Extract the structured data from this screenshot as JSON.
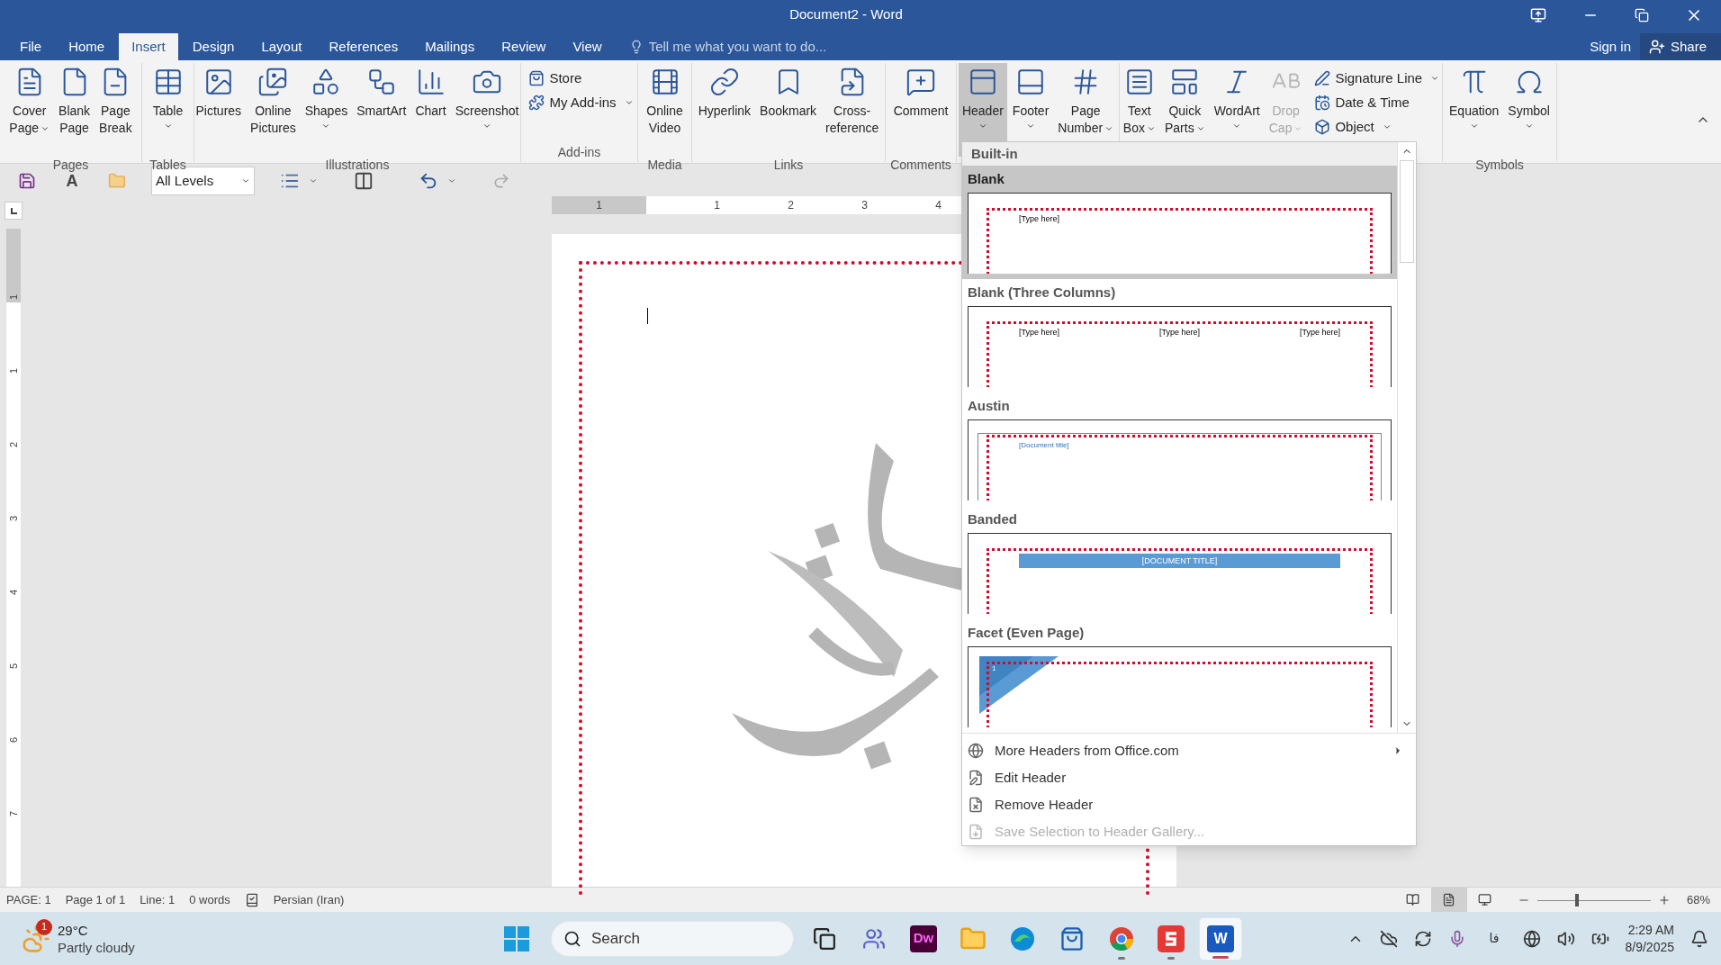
{
  "window": {
    "title": "Document2 - Word"
  },
  "tabs": [
    {
      "label": "File",
      "selected": false
    },
    {
      "label": "Home",
      "selected": false
    },
    {
      "label": "Insert",
      "selected": true
    },
    {
      "label": "Design",
      "selected": false
    },
    {
      "label": "Layout",
      "selected": false
    },
    {
      "label": "References",
      "selected": false
    },
    {
      "label": "Mailings",
      "selected": false
    },
    {
      "label": "Review",
      "selected": false
    },
    {
      "label": "View",
      "selected": false
    }
  ],
  "tell_me": {
    "placeholder": "Tell me what you want to do..."
  },
  "account": {
    "sign_in": "Sign in",
    "share": "Share"
  },
  "ribbon_groups": [
    {
      "label": "Pages",
      "buttons": [
        {
          "kind": "big",
          "lines": [
            "Cover",
            "Page"
          ],
          "dropdown": true,
          "pressed": false,
          "disabled": false
        },
        {
          "kind": "big",
          "lines": [
            "Blank",
            "Page"
          ],
          "dropdown": false,
          "pressed": false,
          "disabled": false
        },
        {
          "kind": "big",
          "lines": [
            "Page",
            "Break"
          ],
          "dropdown": false,
          "pressed": false,
          "disabled": false
        }
      ]
    },
    {
      "label": "Tables",
      "buttons": [
        {
          "kind": "big",
          "lines": [
            "Table"
          ],
          "dropdown": true,
          "pressed": false,
          "disabled": false
        }
      ]
    },
    {
      "label": "Illustrations",
      "buttons": [
        {
          "kind": "big",
          "lines": [
            "Pictures"
          ],
          "dropdown": false,
          "pressed": false,
          "disabled": false
        },
        {
          "kind": "big",
          "lines": [
            "Online",
            "Pictures"
          ],
          "dropdown": false,
          "pressed": false,
          "disabled": false
        },
        {
          "kind": "big",
          "lines": [
            "Shapes"
          ],
          "dropdown": true,
          "pressed": false,
          "disabled": false
        },
        {
          "kind": "big",
          "lines": [
            "SmartArt"
          ],
          "dropdown": false,
          "pressed": false,
          "disabled": false
        },
        {
          "kind": "big",
          "lines": [
            "Chart"
          ],
          "dropdown": false,
          "pressed": false,
          "disabled": false
        },
        {
          "kind": "big",
          "lines": [
            "Screenshot"
          ],
          "dropdown": true,
          "pressed": false,
          "disabled": false
        }
      ]
    },
    {
      "label": "Add-ins",
      "buttons": [
        {
          "kind": "small",
          "lines": [
            "Store"
          ],
          "dropdown": false,
          "pressed": false,
          "disabled": false
        },
        {
          "kind": "small",
          "lines": [
            "My Add-ins"
          ],
          "dropdown": true,
          "pressed": false,
          "disabled": false
        }
      ]
    },
    {
      "label": "Media",
      "buttons": [
        {
          "kind": "big",
          "lines": [
            "Online",
            "Video"
          ],
          "dropdown": false,
          "pressed": false,
          "disabled": false
        }
      ]
    },
    {
      "label": "Links",
      "buttons": [
        {
          "kind": "big",
          "lines": [
            "Hyperlink"
          ],
          "dropdown": false,
          "pressed": false,
          "disabled": false
        },
        {
          "kind": "big",
          "lines": [
            "Bookmark"
          ],
          "dropdown": false,
          "pressed": false,
          "disabled": false
        },
        {
          "kind": "big",
          "lines": [
            "Cross-",
            "reference"
          ],
          "dropdown": false,
          "pressed": false,
          "disabled": false
        }
      ]
    },
    {
      "label": "Comments",
      "buttons": [
        {
          "kind": "big",
          "lines": [
            "Comment"
          ],
          "dropdown": false,
          "pressed": false,
          "disabled": false
        }
      ]
    },
    {
      "buttons": [
        {
          "kind": "big",
          "lines": [
            "Header"
          ],
          "dropdown": true,
          "pressed": true,
          "disabled": false
        },
        {
          "kind": "big",
          "lines": [
            "Footer"
          ],
          "dropdown": true,
          "pressed": false,
          "disabled": false
        },
        {
          "kind": "big",
          "lines": [
            "Page",
            "Number"
          ],
          "dropdown": true,
          "pressed": false,
          "disabled": false
        }
      ]
    },
    {
      "buttons": [
        {
          "kind": "big",
          "lines": [
            "Text",
            "Box"
          ],
          "dropdown": true,
          "pressed": false,
          "disabled": false
        },
        {
          "kind": "big",
          "lines": [
            "Quick",
            "Parts"
          ],
          "dropdown": true,
          "pressed": false,
          "disabled": false
        },
        {
          "kind": "big",
          "lines": [
            "WordArt"
          ],
          "dropdown": true,
          "pressed": false,
          "disabled": false
        },
        {
          "kind": "big",
          "lines": [
            "Drop",
            "Cap"
          ],
          "dropdown": true,
          "pressed": false,
          "disabled": true
        },
        {
          "kind": "small",
          "lines": [
            "Signature Line"
          ],
          "dropdown": true,
          "pressed": false,
          "disabled": false
        },
        {
          "kind": "small",
          "lines": [
            "Date & Time"
          ],
          "dropdown": false,
          "pressed": false,
          "disabled": false
        },
        {
          "kind": "small",
          "lines": [
            "Object"
          ],
          "dropdown": true,
          "pressed": false,
          "disabled": false
        }
      ]
    },
    {
      "label": "Symbols",
      "buttons": [
        {
          "kind": "big",
          "lines": [
            "Equation"
          ],
          "dropdown": true,
          "pressed": false,
          "disabled": false
        },
        {
          "kind": "big",
          "lines": [
            "Symbol"
          ],
          "dropdown": true,
          "pressed": false,
          "disabled": false
        }
      ]
    }
  ],
  "quick_toolbar": {
    "font_button": "A",
    "levels": "All Levels"
  },
  "ruler": {
    "horizontal": [
      "1",
      "1",
      "2",
      "3",
      "4"
    ],
    "vertical": [
      "1",
      "1",
      "2",
      "3",
      "4",
      "5",
      "6",
      "7"
    ]
  },
  "header_gallery": {
    "section": "Built-in",
    "items": [
      {
        "name": "Blank",
        "kind": "blank",
        "selected": true,
        "placeholders": [
          "[Type here]"
        ]
      },
      {
        "name": "Blank (Three Columns)",
        "kind": "three",
        "selected": false,
        "placeholders": [
          "[Type here]",
          "[Type here]",
          "[Type here]"
        ]
      },
      {
        "name": "Austin",
        "kind": "austin",
        "selected": false,
        "placeholders": [
          "[Document title]"
        ]
      },
      {
        "name": "Banded",
        "kind": "banded",
        "selected": false,
        "placeholders": [
          "[DOCUMENT TITLE]"
        ]
      },
      {
        "name": "Facet (Even Page)",
        "kind": "facet",
        "selected": false,
        "placeholders": [
          "1"
        ]
      }
    ],
    "menu": [
      {
        "label": "More Headers from Office.com",
        "disabled": false,
        "submenu": true
      },
      {
        "label": "Edit Header",
        "disabled": false,
        "submenu": false
      },
      {
        "label": "Remove Header",
        "disabled": false,
        "submenu": false
      },
      {
        "label": "Save Selection to Header Gallery...",
        "disabled": true,
        "submenu": false
      }
    ]
  },
  "status_bar": {
    "items": [
      "PAGE: 1",
      "Page 1 of 1",
      "Line: 1",
      "0 words"
    ],
    "language": "Persian (Iran)",
    "views": [
      {
        "selected": false
      },
      {
        "selected": true
      },
      {
        "selected": false
      }
    ],
    "zoom": {
      "level": 0.33,
      "reading": "68%"
    }
  },
  "taskbar": {
    "weather": {
      "badge": "1",
      "temperature": "29°C",
      "condition": "Partly cloudy"
    },
    "search": {
      "placeholder": "Search"
    },
    "apps": [
      {
        "kind": "taskview",
        "running": false,
        "selected": false
      },
      {
        "kind": "teams",
        "running": false,
        "selected": false
      },
      {
        "kind": "dw",
        "label": "Dw",
        "running": false,
        "selected": false
      },
      {
        "kind": "explorer",
        "running": false,
        "selected": false
      },
      {
        "kind": "edge",
        "running": false,
        "selected": false
      },
      {
        "kind": "store",
        "running": false,
        "selected": false
      },
      {
        "kind": "chrome",
        "running": true,
        "selected": false
      },
      {
        "kind": "sapp",
        "running": true,
        "selected": false
      },
      {
        "kind": "word",
        "label": "W",
        "running": true,
        "selected": true
      }
    ],
    "input_language": "فا",
    "time": "2:29 AM",
    "date": "8/9/2025"
  }
}
